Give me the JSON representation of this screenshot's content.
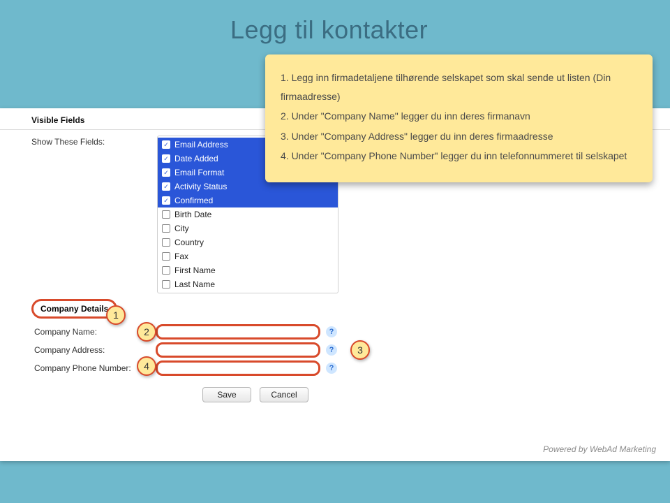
{
  "page": {
    "title": "Legg til kontakter"
  },
  "callout": {
    "line1": "1. Legg inn firmadetaljene tilhørende selskapet som skal sende ut listen (Din firmaadresse)",
    "line2": "2. Under \"Company Name\" legger du inn deres firmanavn",
    "line3": "3. Under \"Company Address\" legger du inn deres firmaadresse",
    "line4": "4. Under \"Company Phone Number\" legger du inn telefonnummeret til selskapet"
  },
  "visible_fields": {
    "header": "Visible Fields",
    "show_label": "Show These Fields:",
    "items": [
      {
        "label": "Email Address",
        "checked": true,
        "selected": true
      },
      {
        "label": "Date Added",
        "checked": true,
        "selected": true
      },
      {
        "label": "Email Format",
        "checked": true,
        "selected": true
      },
      {
        "label": "Activity Status",
        "checked": true,
        "selected": true
      },
      {
        "label": "Confirmed",
        "checked": true,
        "selected": true
      },
      {
        "label": "Birth Date",
        "checked": false,
        "selected": false
      },
      {
        "label": "City",
        "checked": false,
        "selected": false
      },
      {
        "label": "Country",
        "checked": false,
        "selected": false
      },
      {
        "label": "Fax",
        "checked": false,
        "selected": false
      },
      {
        "label": "First Name",
        "checked": false,
        "selected": false
      },
      {
        "label": "Last Name",
        "checked": false,
        "selected": false
      }
    ]
  },
  "company": {
    "header": "Company Details",
    "name_label": "Company Name:",
    "address_label": "Company Address:",
    "phone_label": "Company Phone Number:",
    "name_value": "",
    "address_value": "",
    "phone_value": ""
  },
  "buttons": {
    "save": "Save",
    "cancel": "Cancel"
  },
  "annotations": {
    "a1": "1",
    "a2": "2",
    "a3": "3",
    "a4": "4"
  },
  "footer": {
    "text": "Powered by WebAd Marketing"
  }
}
